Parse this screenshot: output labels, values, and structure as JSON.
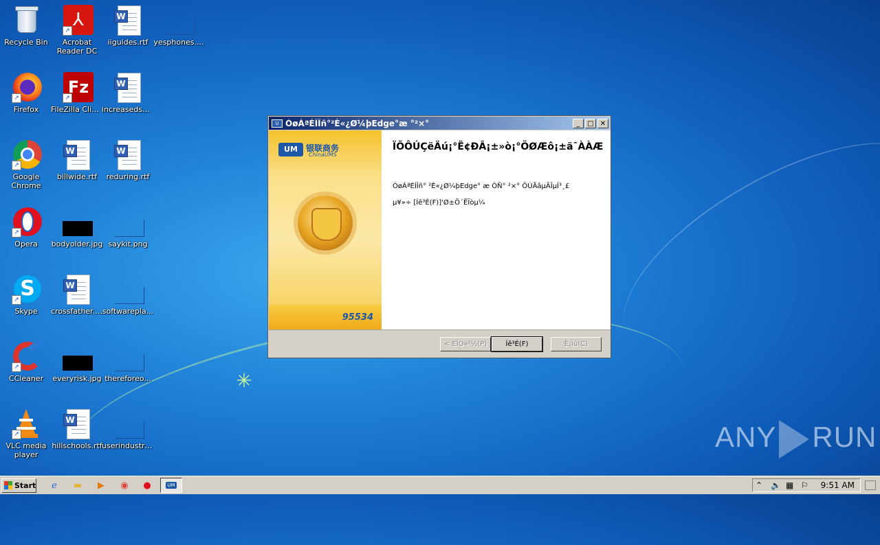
{
  "desktop": {
    "icons": [
      {
        "label": "Recycle Bin"
      },
      {
        "label": "Acrobat Reader DC"
      },
      {
        "label": "iiguides.rtf"
      },
      {
        "label": "yesphones...."
      },
      {
        "label": "Firefox"
      },
      {
        "label": "FileZilla Client"
      },
      {
        "label": "increasedse..."
      },
      {
        "label": "Google Chrome"
      },
      {
        "label": "billwide.rtf"
      },
      {
        "label": "reduring.rtf"
      },
      {
        "label": "Opera"
      },
      {
        "label": "bodyolder.jpg"
      },
      {
        "label": "saykit.png"
      },
      {
        "label": "Skype"
      },
      {
        "label": "crossfather.rtf"
      },
      {
        "label": "softwarepla..."
      },
      {
        "label": "CCleaner"
      },
      {
        "label": "everyrisk.jpg"
      },
      {
        "label": "thereforeo..."
      },
      {
        "label": "VLC media player"
      },
      {
        "label": "hillschools.rtf"
      },
      {
        "label": "userindustri..."
      }
    ]
  },
  "window": {
    "title": "ÒøÁªÉÌÎñ°²È«¿Ø¼þEdge°æ °²×°",
    "heading": "ÏÕÔÚÇëÄú¡°Ë¢ÐÂ¡±»ò¡°ÖØÆô¡±ä¯ÀÀÆ",
    "para_line1": "ÒøÁªÉÌÎñ° ²È«¿Ø¼þEdge° æ ÒÑ° ²×° ÔÚÃâµÄÎµÍ³¸£",
    "para_line2": "µ¥»÷ [Íê³É(F)]'Ø±Õ´ËÏòµ¼",
    "logo_cn": "银联商务",
    "logo_en": "ChinaUMS",
    "phone": "95534",
    "buttons": {
      "back": "< ÉÏÒ»²½(P)",
      "finish": "Íê³É(F)",
      "cancel": "È¡Ïû(C)"
    }
  },
  "taskbar": {
    "start_label": "Start",
    "clock": "9:51 AM"
  },
  "watermark": {
    "left": "ANY",
    "right": "RUN"
  }
}
